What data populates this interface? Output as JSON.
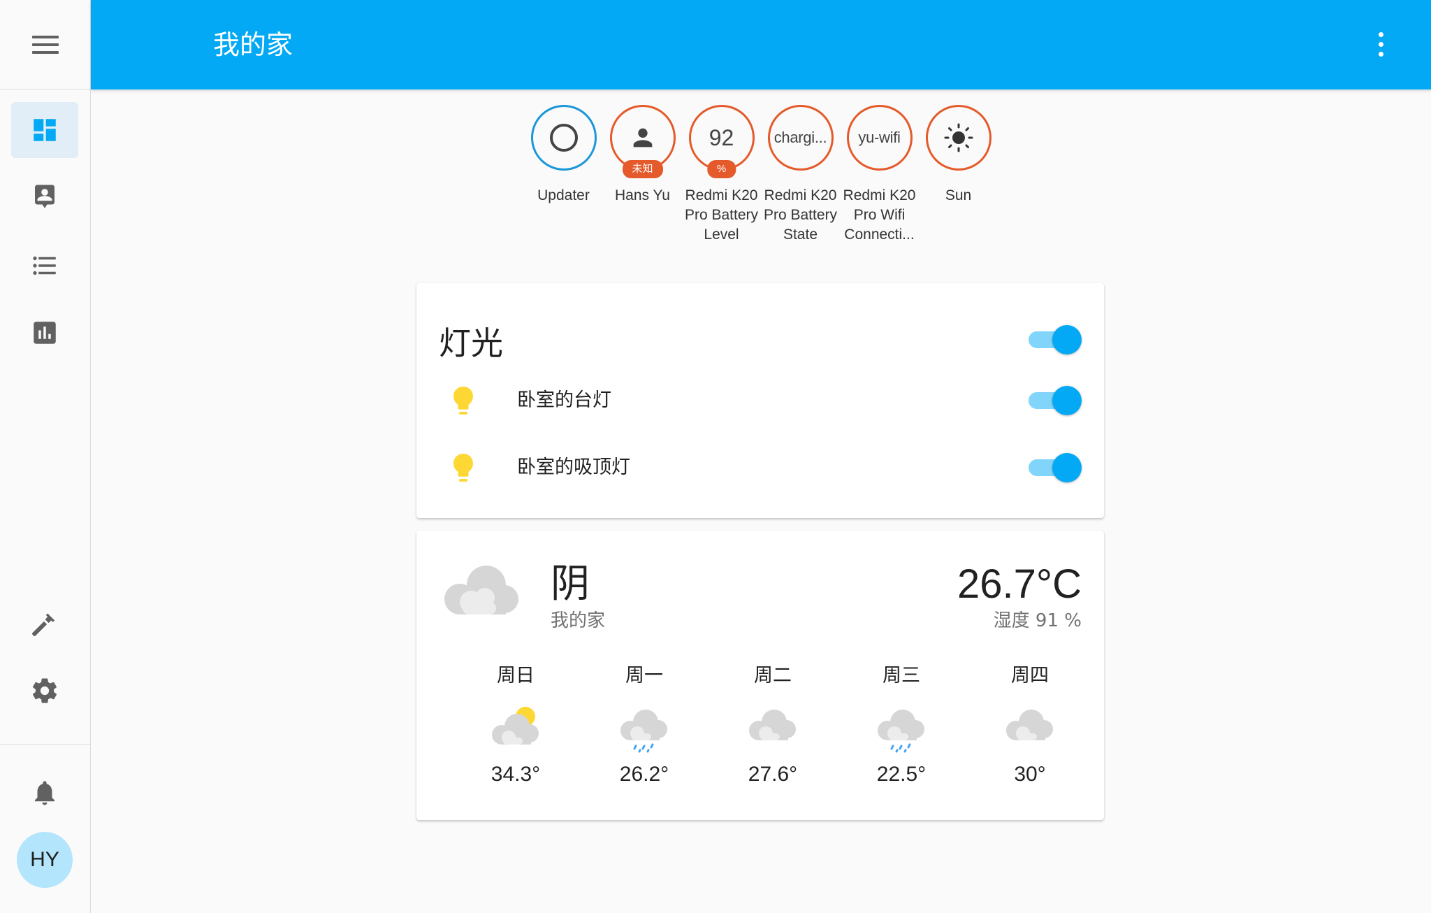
{
  "header": {
    "title": "我的家"
  },
  "sidebar": {
    "items": [
      {
        "name": "overview",
        "icon": "dashboard-icon",
        "active": true
      },
      {
        "name": "map",
        "icon": "account-location-icon"
      },
      {
        "name": "logbook",
        "icon": "format-list-bulleted-icon"
      },
      {
        "name": "history",
        "icon": "chart-box-icon"
      },
      {
        "name": "developer-tools",
        "icon": "hammer-icon"
      },
      {
        "name": "configuration",
        "icon": "cog-icon"
      },
      {
        "name": "notifications",
        "icon": "bell-icon"
      }
    ],
    "user_initials": "HY"
  },
  "badges": [
    {
      "label": "Updater",
      "value": "",
      "unit": "",
      "icon": "updater-circle-icon",
      "ring_color": "#1b96d8"
    },
    {
      "label": "Hans Yu",
      "value": "",
      "unit": "未知",
      "icon": "person-icon",
      "ring_color": "#e45a2a"
    },
    {
      "label": "Redmi K20 Pro Battery Level",
      "value": "92",
      "unit": "%",
      "ring_color": "#e45a2a"
    },
    {
      "label": "Redmi K20 Pro Battery State",
      "value": "chargi...",
      "unit": "",
      "ring_color": "#e45a2a"
    },
    {
      "label": "Redmi K20 Pro Wifi Connecti...",
      "value": "yu-wifi",
      "unit": "",
      "ring_color": "#e45a2a"
    },
    {
      "label": "Sun",
      "value": "",
      "unit": "",
      "icon": "sun-icon",
      "ring_color": "#e45a2a"
    }
  ],
  "lights_card": {
    "title": "灯光",
    "master_on": true,
    "entities": [
      {
        "name": "卧室的台灯",
        "on": true,
        "icon": "lightbulb-icon"
      },
      {
        "name": "卧室的吸顶灯",
        "on": true,
        "icon": "lightbulb-icon"
      }
    ]
  },
  "weather": {
    "condition": "阴",
    "location": "我的家",
    "temperature": "26.7°C",
    "humidity": "湿度 91 %",
    "forecast": [
      {
        "day": "周日",
        "icon": "partly-cloudy-icon",
        "temp": "34.3°"
      },
      {
        "day": "周一",
        "icon": "rainy-icon",
        "temp": "26.2°"
      },
      {
        "day": "周二",
        "icon": "cloudy-icon",
        "temp": "27.6°"
      },
      {
        "day": "周三",
        "icon": "rainy-icon",
        "temp": "22.5°"
      },
      {
        "day": "周四",
        "icon": "cloudy-icon",
        "temp": "30°"
      }
    ]
  },
  "colors": {
    "primary": "#03a9f4",
    "badge_ring": "#e45a2a",
    "toggle_track": "#81d4fa",
    "bulb": "#fdd835"
  }
}
